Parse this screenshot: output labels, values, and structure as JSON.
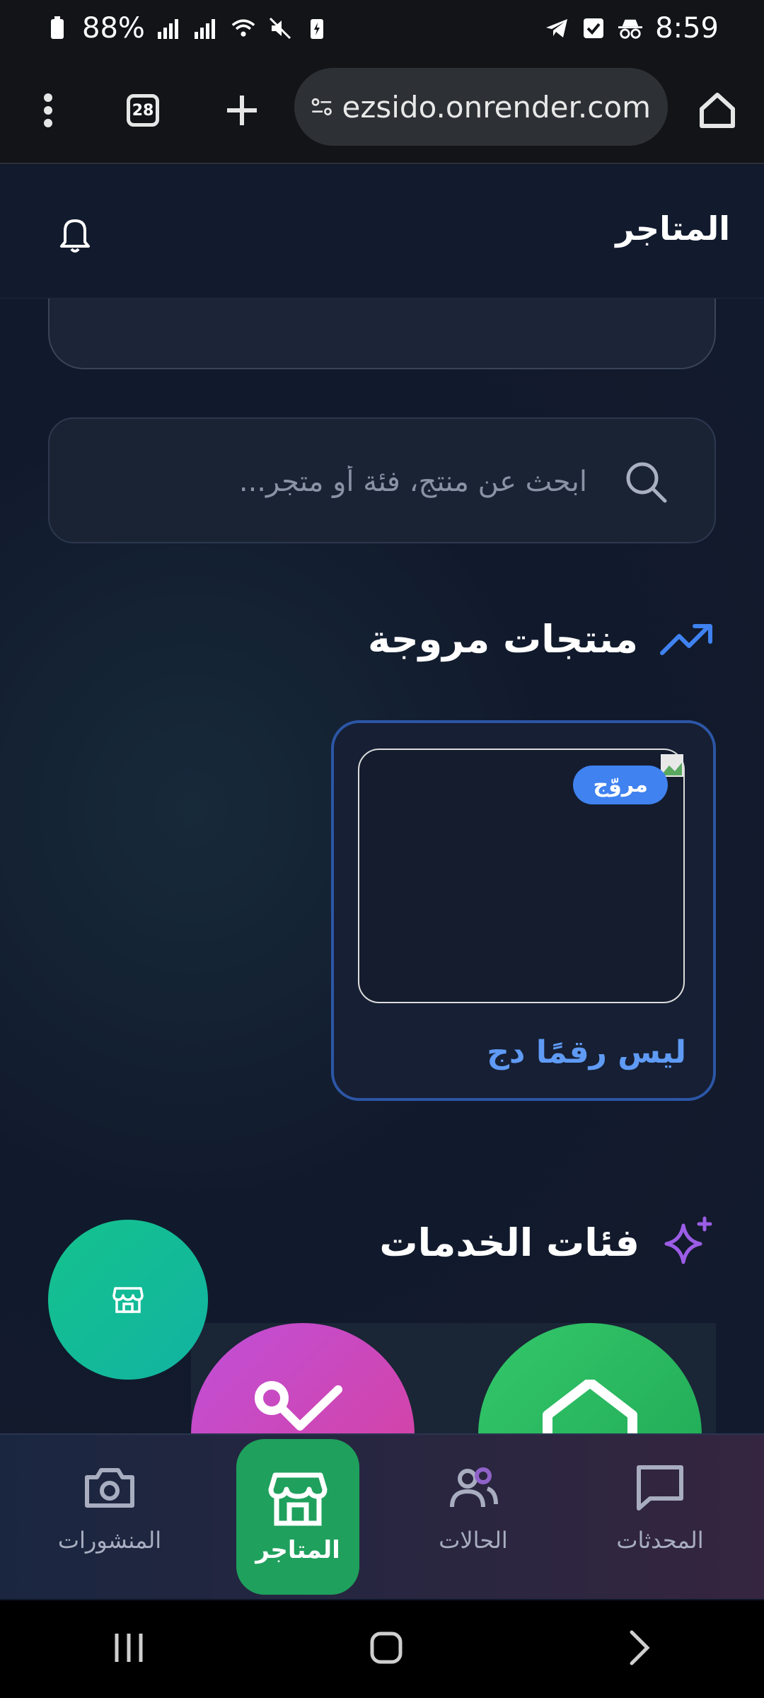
{
  "status_bar": {
    "battery": "88%",
    "time": "8:59"
  },
  "browser": {
    "tab_count": "28",
    "url": "ezsido.onrender.com"
  },
  "header": {
    "title": "المتاجر"
  },
  "search": {
    "placeholder": "ابحث عن منتج، فئة أو متجر..."
  },
  "sections": {
    "promoted_title": "منتجات مروجة",
    "services_title": "فئات الخدمات"
  },
  "product": {
    "badge": "مروّج",
    "price": "ليس رقمًا دج"
  },
  "bottom_nav": {
    "items": [
      {
        "label": "المنشورات"
      },
      {
        "label": "المتاجر"
      },
      {
        "label": "الحالات"
      },
      {
        "label": "المحدثات"
      }
    ]
  },
  "colors": {
    "accent_blue": "#3f82f0",
    "active_green": "#1fa05c",
    "fab_teal": "#14c28d"
  }
}
